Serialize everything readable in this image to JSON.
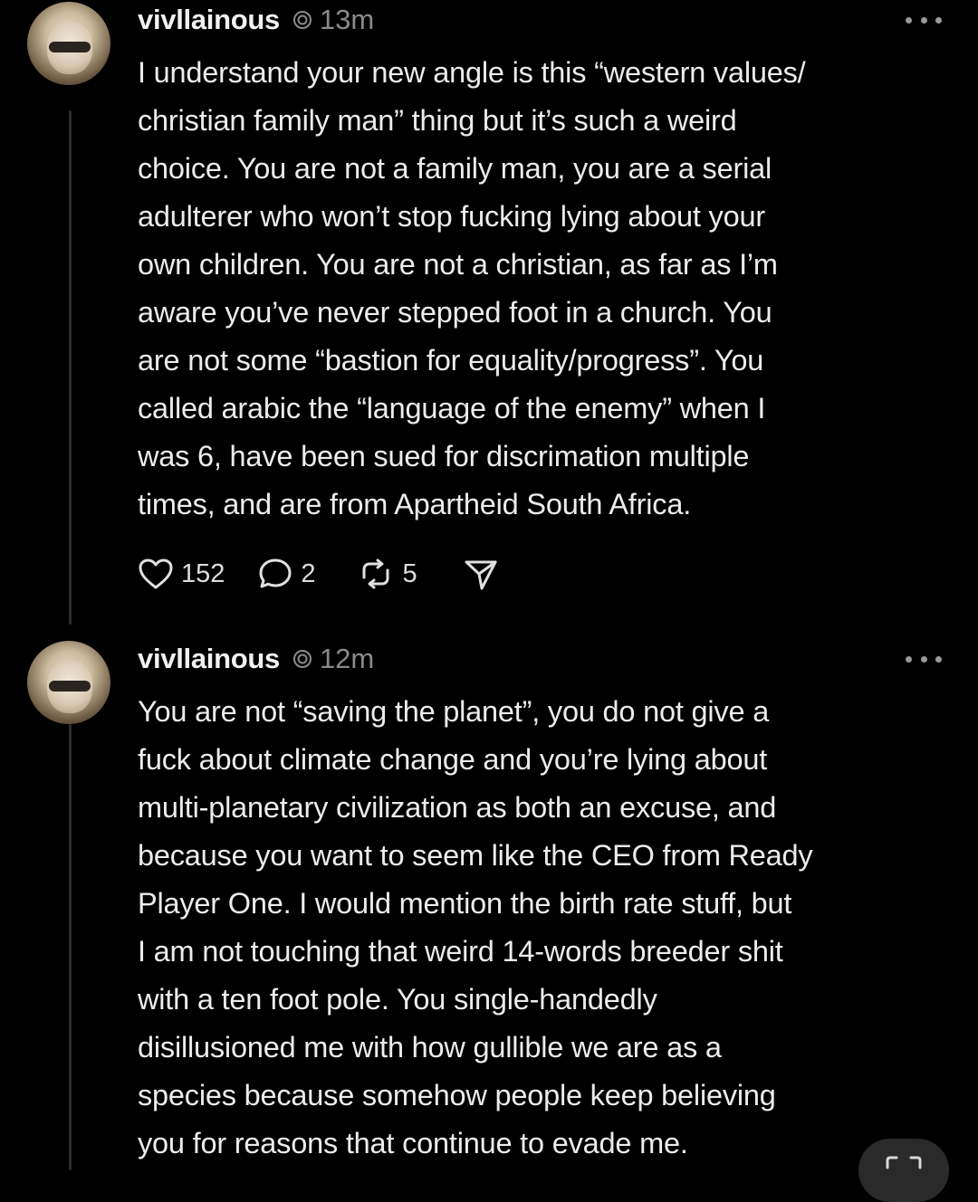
{
  "posts": [
    {
      "username": "vivllainous",
      "time": "13m",
      "lines": [
        "I understand your new angle is this “western values/",
        "christian family man” thing but it’s such a weird",
        "choice. You are not a family man, you are a serial",
        "adulterer who won’t stop fucking lying about your",
        "own children. You are not a christian, as far as I’m",
        "aware you’ve never stepped foot in a church. You",
        "are not some “bastion for equality/progress”. You",
        "called arabic the “language of the enemy” when I",
        "was 6, have been sued for discrimation multiple",
        "times, and are from Apartheid South Africa."
      ],
      "likes": "152",
      "replies": "2",
      "reposts": "5"
    },
    {
      "username": "vivllainous",
      "time": "12m",
      "lines": [
        "You are not “saving the planet”, you do not give a",
        "fuck about climate change and you’re lying about",
        "multi-planetary civilization as both an excuse, and",
        "because you want to seem like the CEO from Ready",
        "Player One. I would mention the birth rate stuff, but",
        "I am not touching that weird 14-words breeder shit",
        "with a ten foot pole. You single-handedly",
        "disillusioned me with how gullible we are as a",
        "species because somehow people keep believing",
        "you for reasons that continue to evade me."
      ]
    }
  ],
  "icons": {
    "clock": "clock-icon",
    "more": "more-icon",
    "like": "heart-icon",
    "reply": "comment-icon",
    "repost": "repost-icon",
    "share": "send-icon",
    "fab": "expand-icon"
  },
  "colors": {
    "background": "#000000",
    "text": "#ececec",
    "muted": "#8a8a8a",
    "thread_line": "#2c2c2c"
  }
}
